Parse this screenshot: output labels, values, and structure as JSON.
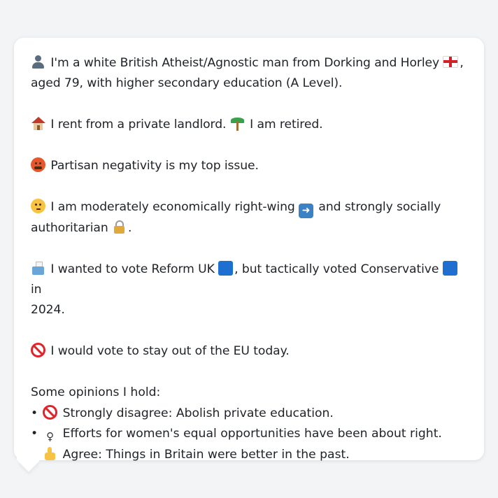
{
  "profile": {
    "intro_line1": "I'm a white British Atheist/Agnostic man from Dorking and Horley",
    "intro_line1_end": ",",
    "intro_line2": "aged 79, with higher secondary education (A Level).",
    "housing": "I rent from a private landlord.",
    "work": "I am retired.",
    "top_issue": "Partisan negativity is my top issue.",
    "economics_a": "I am moderately economically right-wing",
    "economics_b": "and strongly socially",
    "economics_c": "authoritarian",
    "economics_c_end": ".",
    "vote_a": "I wanted to vote Reform UK",
    "vote_b": ", but tactically voted Conservative",
    "vote_c": "in",
    "vote_d": "2024.",
    "eu": "I would vote to stay out of the EU today."
  },
  "opinions": {
    "heading": "Some opinions I hold:",
    "items": [
      {
        "bullet": "•",
        "icon": "no-entry-icon",
        "text": "Strongly disagree: Abolish private education."
      },
      {
        "bullet": "•",
        "icon": "female-sign-icon",
        "text": "Efforts for women's equal opportunities have been about right."
      },
      {
        "bullet": "•",
        "icon": "thumbs-up-icon",
        "text": "Agree: Things in Britain were better in the past."
      }
    ]
  },
  "colors": {
    "reform_square": "#1f6fd1",
    "conservative_square": "#1f6fd1",
    "background": "#f3f4f6",
    "card": "#ffffff"
  }
}
